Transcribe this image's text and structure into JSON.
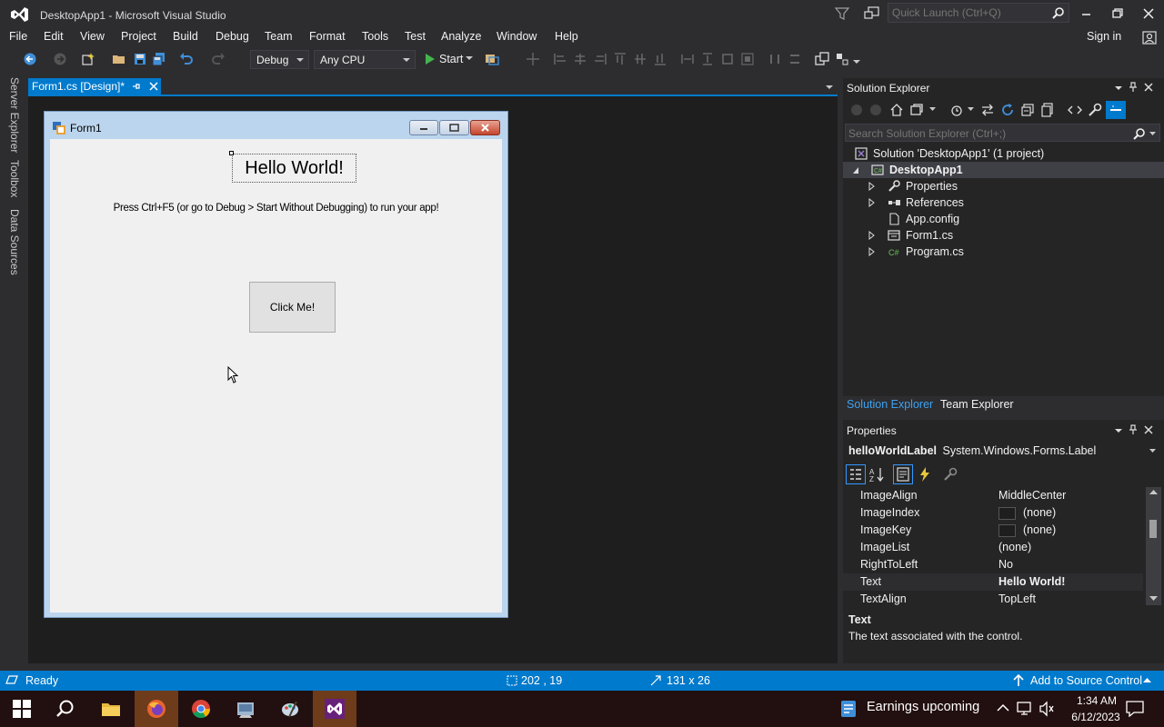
{
  "window": {
    "title": "DesktopApp1 - Microsoft Visual Studio",
    "quick_launch_placeholder": "Quick Launch (Ctrl+Q)"
  },
  "menu": {
    "items": [
      "File",
      "Edit",
      "View",
      "Project",
      "Build",
      "Debug",
      "Team",
      "Format",
      "Tools",
      "Test",
      "Analyze",
      "Window",
      "Help"
    ],
    "sign_in": "Sign in"
  },
  "toolbar": {
    "configuration": "Debug",
    "platform": "Any CPU",
    "start_label": "Start"
  },
  "left_tabs": [
    "Server Explorer",
    "Toolbox",
    "Data Sources"
  ],
  "document_tab": {
    "label": "Form1.cs [Design]*"
  },
  "form": {
    "title": "Form1",
    "hello_label": "Hello World!",
    "instruction": "Press Ctrl+F5 (or go to Debug > Start Without Debugging) to run your app!",
    "button_label": "Click Me!"
  },
  "solution_explorer": {
    "title": "Solution Explorer",
    "search_placeholder": "Search Solution Explorer (Ctrl+;)",
    "solution": "Solution 'DesktopApp1' (1 project)",
    "project": "DesktopApp1",
    "items": [
      "Properties",
      "References",
      "App.config",
      "Form1.cs",
      "Program.cs"
    ],
    "bottom_tabs": [
      "Solution Explorer",
      "Team Explorer"
    ]
  },
  "properties": {
    "title": "Properties",
    "object_name": "helloWorldLabel",
    "object_type": "System.Windows.Forms.Label",
    "rows": [
      {
        "name": "ImageAlign",
        "value": "MiddleCenter"
      },
      {
        "name": "ImageIndex",
        "value": "(none)"
      },
      {
        "name": "ImageKey",
        "value": "(none)"
      },
      {
        "name": "ImageList",
        "value": "(none)"
      },
      {
        "name": "RightToLeft",
        "value": "No"
      },
      {
        "name": "Text",
        "value": "Hello World!"
      },
      {
        "name": "TextAlign",
        "value": "TopLeft"
      }
    ],
    "description_title": "Text",
    "description_text": "The text associated with the control."
  },
  "status": {
    "ready": "Ready",
    "position": "202 , 19",
    "size": "131 x 26",
    "source_control": "Add to Source Control"
  },
  "taskbar": {
    "news": "Earnings upcoming",
    "time": "1:34 AM",
    "date": "6/12/2023"
  },
  "colors": {
    "accent": "#007acc",
    "ide_background": "#2d2d30",
    "designer_background": "#1e1e1e",
    "form_background": "#f0f0f0",
    "taskbar": "#220f0f"
  }
}
